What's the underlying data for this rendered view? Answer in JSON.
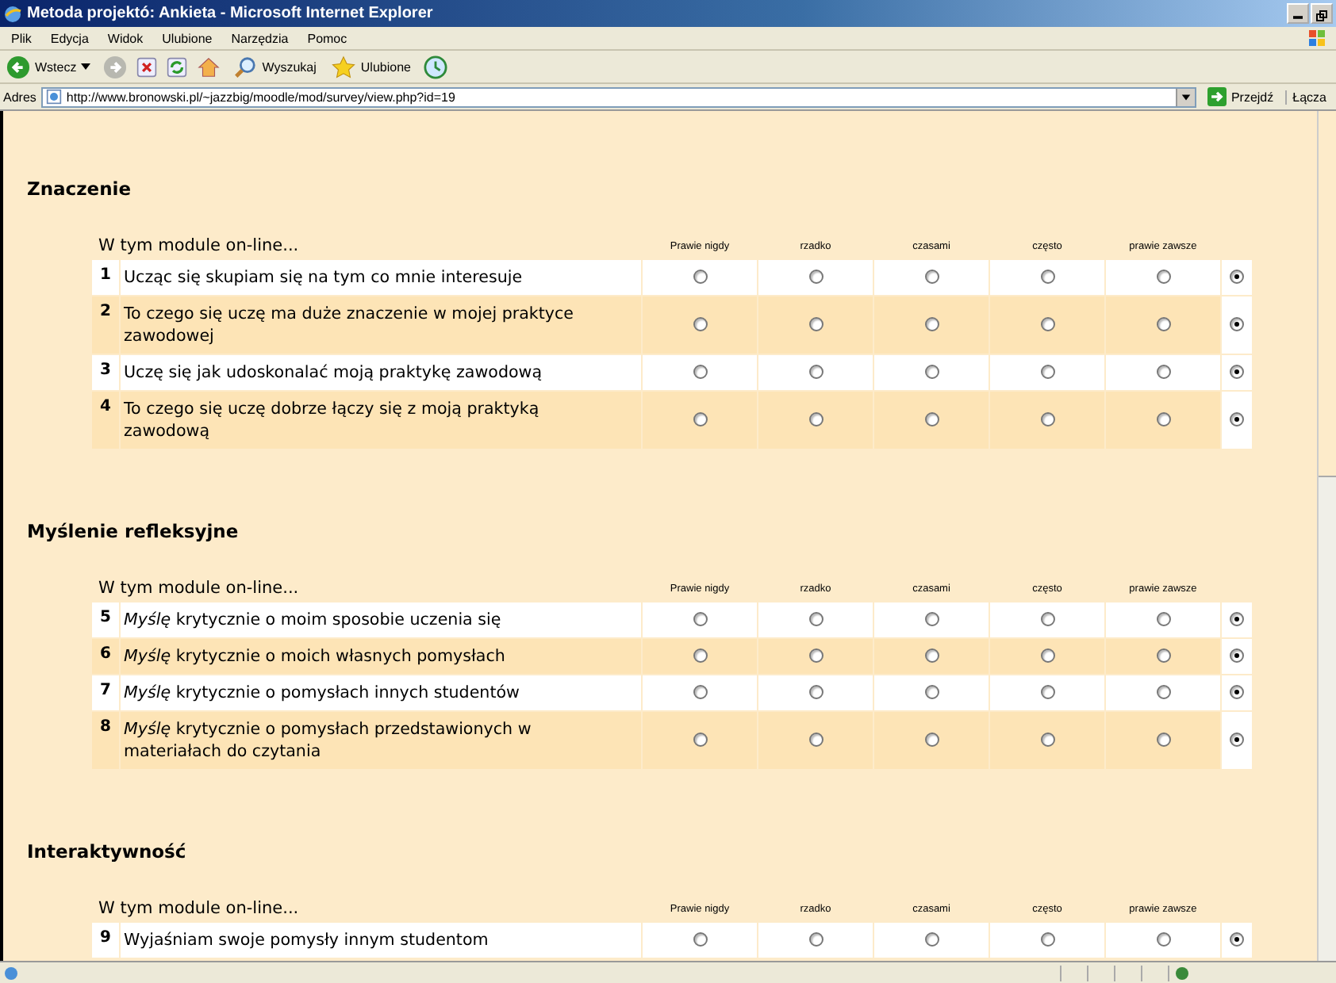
{
  "window": {
    "title": "Metoda projektó: Ankieta - Microsoft Internet Explorer"
  },
  "menu": [
    "Plik",
    "Edycja",
    "Widok",
    "Ulubione",
    "Narzędzia",
    "Pomoc"
  ],
  "toolbar": {
    "back": "Wstecz",
    "search": "Wyszukaj",
    "favorites": "Ulubione"
  },
  "address": {
    "label": "Adres",
    "value": "http://www.bronowski.pl/~jazzbig/moodle/mod/survey/view.php?id=19",
    "go": "Przejdź",
    "links": "Łącza"
  },
  "sections": [
    {
      "title": "Znaczenie",
      "header": "W tym module on-line...",
      "columns": [
        "Prawie nigdy",
        "rzadko",
        "czasami",
        "często",
        "prawie zawsze"
      ],
      "rows": [
        {
          "number": "1",
          "text": "Ucząc się skupiam się na tym co mnie interesuje",
          "options": [
            {
              "selected": false
            },
            {
              "selected": false
            },
            {
              "selected": false
            },
            {
              "selected": false
            },
            {
              "selected": false
            },
            {
              "selected": true
            }
          ]
        },
        {
          "number": "2",
          "text": "To czego się uczę ma duże znaczenie w mojej praktyce zawodowej",
          "options": [
            {
              "selected": false
            },
            {
              "selected": false
            },
            {
              "selected": false
            },
            {
              "selected": false
            },
            {
              "selected": false
            },
            {
              "selected": true
            }
          ]
        },
        {
          "number": "3",
          "text": "Uczę się jak udoskonalać moją praktykę zawodową",
          "options": [
            {
              "selected": false
            },
            {
              "selected": false
            },
            {
              "selected": false
            },
            {
              "selected": false
            },
            {
              "selected": false
            },
            {
              "selected": true
            }
          ]
        },
        {
          "number": "4",
          "text": "To czego się uczę dobrze łączy się z moją praktyką zawodową",
          "options": [
            {
              "selected": false
            },
            {
              "selected": false
            },
            {
              "selected": false
            },
            {
              "selected": false
            },
            {
              "selected": false
            },
            {
              "selected": true
            }
          ]
        }
      ]
    },
    {
      "title": "Myślenie refleksyjne",
      "header": "W tym module on-line...",
      "columns": [
        "Prawie nigdy",
        "rzadko",
        "czasami",
        "często",
        "prawie zawsze"
      ],
      "rows": [
        {
          "number": "5",
          "text": "*Myślę* krytycznie o moim sposobie uczenia się",
          "options": [
            {
              "selected": false
            },
            {
              "selected": false
            },
            {
              "selected": false
            },
            {
              "selected": false
            },
            {
              "selected": false
            },
            {
              "selected": true
            }
          ]
        },
        {
          "number": "6",
          "text": "*Myślę* krytycznie o moich własnych pomysłach",
          "options": [
            {
              "selected": false
            },
            {
              "selected": false
            },
            {
              "selected": false
            },
            {
              "selected": false
            },
            {
              "selected": false
            },
            {
              "selected": true
            }
          ]
        },
        {
          "number": "7",
          "text": "*Myślę* krytycznie o pomysłach innych studentów",
          "options": [
            {
              "selected": false
            },
            {
              "selected": false
            },
            {
              "selected": false
            },
            {
              "selected": false
            },
            {
              "selected": false
            },
            {
              "selected": true
            }
          ]
        },
        {
          "number": "8",
          "text": "*Myślę* krytycznie o pomysłach przedstawionych w materiałach do czytania",
          "options": [
            {
              "selected": false
            },
            {
              "selected": false
            },
            {
              "selected": false
            },
            {
              "selected": false
            },
            {
              "selected": false
            },
            {
              "selected": true
            }
          ]
        }
      ]
    },
    {
      "title": "Interaktywność",
      "header": "W tym module on-line...",
      "columns": [
        "Prawie nigdy",
        "rzadko",
        "czasami",
        "często",
        "prawie zawsze"
      ],
      "rows": [
        {
          "number": "9",
          "text": "Wyjaśniam swoje pomysły innym studentom",
          "options": [
            {
              "selected": false
            },
            {
              "selected": false
            },
            {
              "selected": false
            },
            {
              "selected": false
            },
            {
              "selected": false
            },
            {
              "selected": true
            }
          ]
        }
      ]
    }
  ]
}
